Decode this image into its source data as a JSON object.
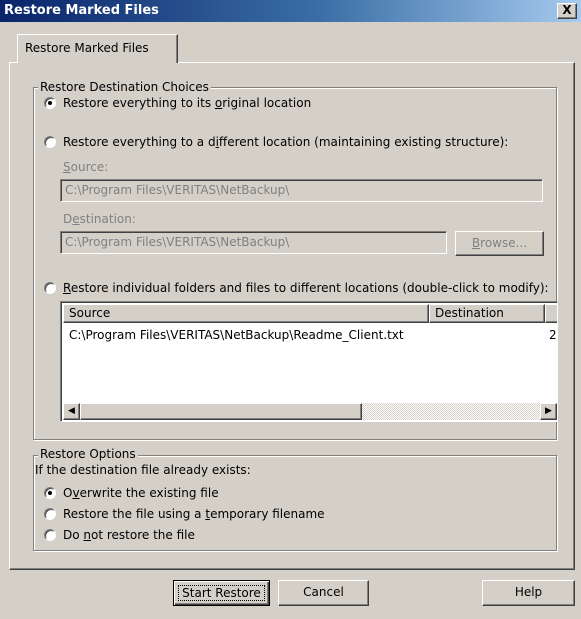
{
  "window": {
    "title": "Restore Marked Files",
    "close_glyph": "X"
  },
  "tab": {
    "label": "Restore Marked Files"
  },
  "destination_group": {
    "title": "Restore Destination Choices",
    "option_original": {
      "before": "Restore everything to its ",
      "key": "o",
      "after": "riginal location",
      "checked": true
    },
    "option_different": {
      "before": "Restore everything to a d",
      "key": "i",
      "after": "fferent location (maintaining existing structure):",
      "checked": false
    },
    "source_label": {
      "key": "S",
      "after": "ource:"
    },
    "source_value": "C:\\Program Files\\VERITAS\\NetBackup\\",
    "destination_label": {
      "before": "D",
      "key": "e",
      "after": "stination:"
    },
    "destination_value": "C:\\Program Files\\VERITAS\\NetBackup\\",
    "browse_button": {
      "key": "B",
      "after": "rowse..."
    },
    "option_individual": {
      "key": "R",
      "after": "estore individual folders and files to different locations (double-click to modify):",
      "checked": false
    },
    "list": {
      "columns": [
        "Source",
        "Destination"
      ],
      "rows": [
        {
          "source": "C:\\Program Files\\VERITAS\\NetBackup\\Readme_Client.txt",
          "overflow": "2"
        }
      ]
    },
    "scroll_left_glyph": "◀",
    "scroll_right_glyph": "▶"
  },
  "options_group": {
    "title": "Restore Options",
    "prompt": "If the destination file already exists:",
    "overwrite": {
      "before": "O",
      "key": "v",
      "after": "erwrite the existing file",
      "checked": true
    },
    "temporary": {
      "before": "Restore the file using a ",
      "key": "t",
      "after": "emporary filename",
      "checked": false
    },
    "donot": {
      "before": "Do ",
      "key": "n",
      "after": "ot restore the file",
      "checked": false
    }
  },
  "buttons": {
    "start": "Start Restore",
    "cancel": "Cancel",
    "help": "Help"
  },
  "icons": {
    "close": "close-icon",
    "scroll_left": "arrow-left-icon",
    "scroll_right": "arrow-right-icon"
  }
}
